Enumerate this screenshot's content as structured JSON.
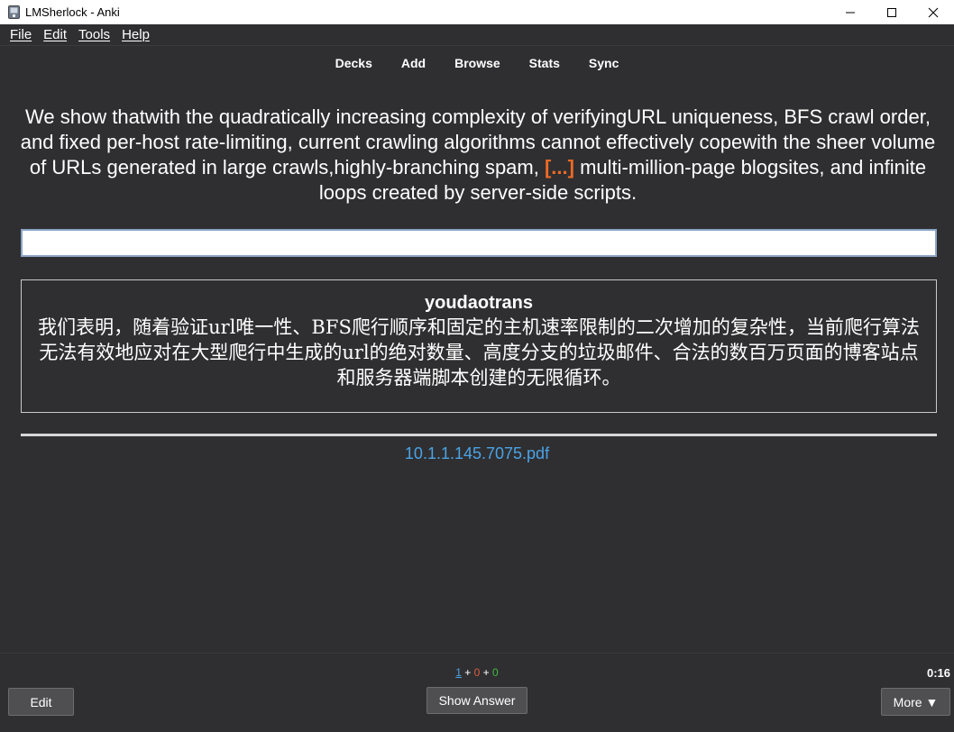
{
  "window": {
    "title": "LMSherlock - Anki",
    "icon": "anki-app-icon"
  },
  "menubar": {
    "items": [
      {
        "label": "File"
      },
      {
        "label": "Edit"
      },
      {
        "label": "Tools"
      },
      {
        "label": "Help"
      }
    ]
  },
  "toolbar": {
    "links": [
      {
        "label": "Decks"
      },
      {
        "label": "Add"
      },
      {
        "label": "Browse"
      },
      {
        "label": "Stats"
      },
      {
        "label": "Sync"
      }
    ]
  },
  "card": {
    "question_before": "We show thatwith the quadratically increasing complexity of verifyingURL uniqueness, BFS crawl order, and fixed per-host rate-limiting, current crawling algorithms cannot effectively copewith the sheer volume of URLs generated in large crawls,highly-branching spam, ",
    "cloze": "[...]",
    "question_after": " multi-million-page blogsites, and infinite loops created by server-side scripts.",
    "answer_input_value": "",
    "translation_title": "youdaotrans",
    "translation_body": "我们表明，随着验证url唯一性、BFS爬行顺序和固定的主机速率限制的二次增加的复杂性，当前爬行算法无法有效地应对在大型爬行中生成的url的绝对数量、高度分支的垃圾邮件、合法的数百万页面的博客站点和服务器端脚本创建的无限循环。",
    "source": "10.1.1.145.7075.pdf"
  },
  "bottombar": {
    "counts": {
      "new": "1",
      "learn": "0",
      "review": "0",
      "sep": " + "
    },
    "timer": "0:16",
    "edit_label": "Edit",
    "show_answer_label": "Show Answer",
    "more_label": "More ▼"
  },
  "colors": {
    "background": "#2f2f31",
    "cloze": "#ec6b25",
    "link": "#4aa3e6",
    "new_count": "#4aa3e6",
    "learn_count": "#d95b3e",
    "review_count": "#3fbc3f"
  }
}
